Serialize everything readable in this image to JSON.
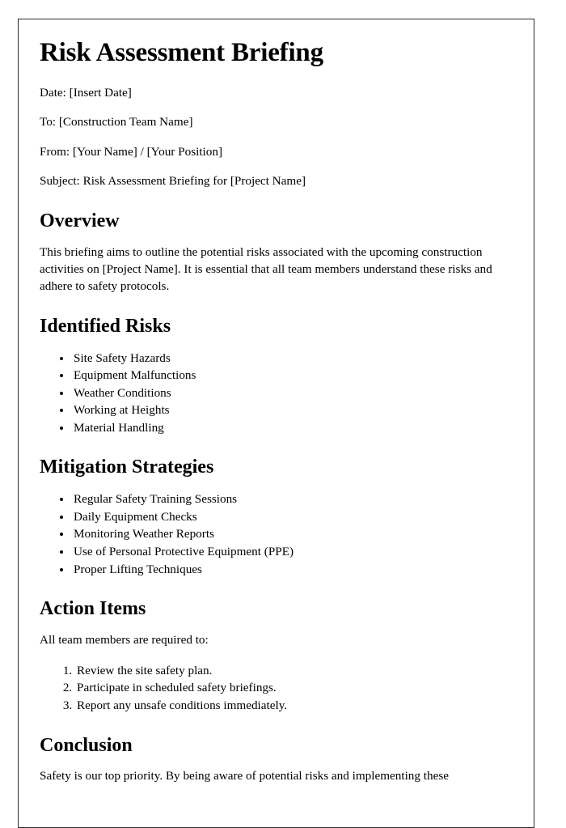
{
  "document": {
    "title": "Risk Assessment Briefing",
    "meta": [
      {
        "label": "Date",
        "text": "Date: [Insert Date]"
      },
      {
        "label": "To",
        "text": "To: [Construction Team Name]"
      },
      {
        "label": "From",
        "text": "From: [Your Name] / [Your Position]"
      },
      {
        "label": "Subject",
        "text": "Subject: Risk Assessment Briefing for [Project Name]"
      }
    ],
    "sections": {
      "overview": {
        "heading": "Overview",
        "paragraph": "This briefing aims to outline the potential risks associated with the upcoming construction activities on [Project Name]. It is essential that all team members understand these risks and adhere to safety protocols."
      },
      "identified_risks": {
        "heading": "Identified Risks",
        "items": [
          "Site Safety Hazards",
          "Equipment Malfunctions",
          "Weather Conditions",
          "Working at Heights",
          "Material Handling"
        ]
      },
      "mitigation_strategies": {
        "heading": "Mitigation Strategies",
        "items": [
          "Regular Safety Training Sessions",
          "Daily Equipment Checks",
          "Monitoring Weather Reports",
          "Use of Personal Protective Equipment (PPE)",
          "Proper Lifting Techniques"
        ]
      },
      "action_items": {
        "heading": "Action Items",
        "intro": "All team members are required to:",
        "items": [
          "Review the site safety plan.",
          "Participate in scheduled safety briefings.",
          "Report any unsafe conditions immediately."
        ]
      },
      "conclusion": {
        "heading": "Conclusion",
        "paragraph": "Safety is our top priority. By being aware of potential risks and implementing these"
      }
    }
  }
}
